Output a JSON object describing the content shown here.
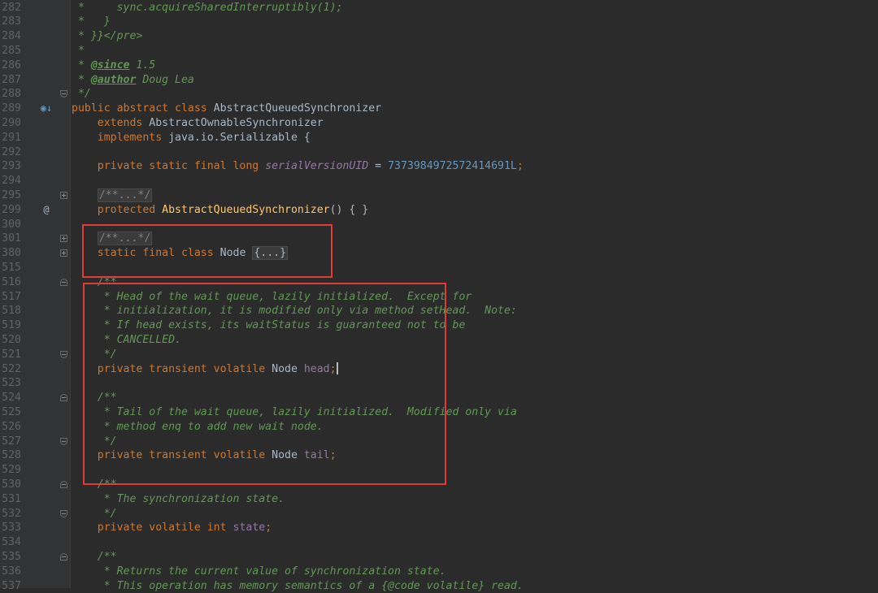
{
  "editor": {
    "lines": [
      {
        "n": "282",
        "fold": "",
        "marker": "",
        "segments": [
          {
            "t": " *     ",
            "c": "doc"
          },
          {
            "t": "sync.acquireSharedInterruptibly(1);",
            "c": "doc"
          }
        ]
      },
      {
        "n": "283",
        "fold": "",
        "marker": "",
        "segments": [
          {
            "t": " *   }",
            "c": "doc"
          }
        ]
      },
      {
        "n": "284",
        "fold": "",
        "marker": "",
        "segments": [
          {
            "t": " * }}</pre>",
            "c": "doc"
          }
        ]
      },
      {
        "n": "285",
        "fold": "",
        "marker": "",
        "segments": [
          {
            "t": " *",
            "c": "doc"
          }
        ]
      },
      {
        "n": "286",
        "fold": "",
        "marker": "",
        "segments": [
          {
            "t": " * ",
            "c": "doc"
          },
          {
            "t": "@since",
            "c": "tag"
          },
          {
            "t": " 1.5",
            "c": "tagv"
          }
        ]
      },
      {
        "n": "287",
        "fold": "",
        "marker": "",
        "segments": [
          {
            "t": " * ",
            "c": "doc"
          },
          {
            "t": "@author",
            "c": "tag"
          },
          {
            "t": " Doug Lea",
            "c": "tagv"
          }
        ]
      },
      {
        "n": "288",
        "fold": "end",
        "marker": "",
        "segments": [
          {
            "t": " */",
            "c": "doc"
          }
        ]
      },
      {
        "n": "289",
        "fold": "",
        "marker": "override",
        "segments": [
          {
            "t": "public abstract class ",
            "c": "kw"
          },
          {
            "t": "AbstractQueuedSynchronizer",
            "c": ""
          }
        ]
      },
      {
        "n": "290",
        "fold": "",
        "marker": "",
        "segments": [
          {
            "t": "    extends ",
            "c": "kw"
          },
          {
            "t": "AbstractOwnableSynchronizer",
            "c": ""
          }
        ]
      },
      {
        "n": "291",
        "fold": "",
        "marker": "",
        "segments": [
          {
            "t": "    implements ",
            "c": "kw"
          },
          {
            "t": "java.io.Serializable {",
            "c": ""
          }
        ]
      },
      {
        "n": "292",
        "fold": "",
        "marker": "",
        "segments": []
      },
      {
        "n": "293",
        "fold": "",
        "marker": "",
        "segments": [
          {
            "t": "    private static final long ",
            "c": "kw"
          },
          {
            "t": "serialVersionUID",
            "c": "ifield"
          },
          {
            "t": " = ",
            "c": ""
          },
          {
            "t": "7373984972572414691L",
            "c": "num"
          },
          {
            "t": ";",
            "c": "kw"
          }
        ]
      },
      {
        "n": "294",
        "fold": "",
        "marker": "",
        "segments": []
      },
      {
        "n": "295",
        "fold": "col",
        "marker": "",
        "segments": [
          {
            "t": "    ",
            "c": ""
          },
          {
            "t": "/**...*/",
            "c": "folded-doc"
          }
        ]
      },
      {
        "n": "299",
        "fold": "",
        "marker": "impl",
        "segments": [
          {
            "t": "    protected ",
            "c": "kw"
          },
          {
            "t": "AbstractQueuedSynchronizer",
            "c": "fn"
          },
          {
            "t": "() { }",
            "c": ""
          }
        ]
      },
      {
        "n": "300",
        "fold": "",
        "marker": "",
        "segments": []
      },
      {
        "n": "301",
        "fold": "col",
        "marker": "",
        "segments": [
          {
            "t": "    ",
            "c": ""
          },
          {
            "t": "/**...*/",
            "c": "folded-doc"
          }
        ]
      },
      {
        "n": "380",
        "fold": "col",
        "marker": "",
        "segments": [
          {
            "t": "    static final class ",
            "c": "kw"
          },
          {
            "t": "Node ",
            "c": ""
          },
          {
            "t": "{...}",
            "c": "folded"
          }
        ]
      },
      {
        "n": "515",
        "fold": "",
        "marker": "",
        "segments": []
      },
      {
        "n": "516",
        "fold": "start",
        "marker": "",
        "segments": [
          {
            "t": "    /**",
            "c": "doc"
          }
        ]
      },
      {
        "n": "517",
        "fold": "",
        "marker": "",
        "segments": [
          {
            "t": "     * Head of the wait queue, lazily initialized.  Except for",
            "c": "doc"
          }
        ]
      },
      {
        "n": "518",
        "fold": "",
        "marker": "",
        "segments": [
          {
            "t": "     * initialization, it is modified only via method setHead.  Note:",
            "c": "doc"
          }
        ]
      },
      {
        "n": "519",
        "fold": "",
        "marker": "",
        "segments": [
          {
            "t": "     * If head exists, its waitStatus is guaranteed not to be",
            "c": "doc"
          }
        ]
      },
      {
        "n": "520",
        "fold": "",
        "marker": "",
        "segments": [
          {
            "t": "     * CANCELLED.",
            "c": "doc"
          }
        ]
      },
      {
        "n": "521",
        "fold": "end",
        "marker": "",
        "segments": [
          {
            "t": "     */",
            "c": "doc"
          }
        ]
      },
      {
        "n": "522",
        "fold": "",
        "marker": "",
        "segments": [
          {
            "t": "    private transient volatile ",
            "c": "kw"
          },
          {
            "t": "Node ",
            "c": ""
          },
          {
            "t": "head",
            "c": "field"
          },
          {
            "t": ";",
            "c": "kw"
          },
          {
            "t": "|",
            "c": "caret"
          }
        ]
      },
      {
        "n": "523",
        "fold": "",
        "marker": "",
        "segments": []
      },
      {
        "n": "524",
        "fold": "start",
        "marker": "",
        "segments": [
          {
            "t": "    /**",
            "c": "doc"
          }
        ]
      },
      {
        "n": "525",
        "fold": "",
        "marker": "",
        "segments": [
          {
            "t": "     * Tail of the wait queue, lazily initialized.  Modified only via",
            "c": "doc"
          }
        ]
      },
      {
        "n": "526",
        "fold": "",
        "marker": "",
        "segments": [
          {
            "t": "     * method enq to add new wait node.",
            "c": "doc"
          }
        ]
      },
      {
        "n": "527",
        "fold": "end",
        "marker": "",
        "segments": [
          {
            "t": "     */",
            "c": "doc"
          }
        ]
      },
      {
        "n": "528",
        "fold": "",
        "marker": "",
        "segments": [
          {
            "t": "    private transient volatile ",
            "c": "kw"
          },
          {
            "t": "Node ",
            "c": ""
          },
          {
            "t": "tail",
            "c": "field"
          },
          {
            "t": ";",
            "c": "kw"
          }
        ]
      },
      {
        "n": "529",
        "fold": "",
        "marker": "",
        "segments": []
      },
      {
        "n": "530",
        "fold": "start",
        "marker": "",
        "segments": [
          {
            "t": "    /**",
            "c": "doc"
          }
        ]
      },
      {
        "n": "531",
        "fold": "",
        "marker": "",
        "segments": [
          {
            "t": "     * The synchronization state.",
            "c": "doc"
          }
        ]
      },
      {
        "n": "532",
        "fold": "end",
        "marker": "",
        "segments": [
          {
            "t": "     */",
            "c": "doc"
          }
        ]
      },
      {
        "n": "533",
        "fold": "",
        "marker": "",
        "segments": [
          {
            "t": "    private volatile int ",
            "c": "kw"
          },
          {
            "t": "state",
            "c": "field"
          },
          {
            "t": ";",
            "c": "kw"
          }
        ]
      },
      {
        "n": "534",
        "fold": "",
        "marker": "",
        "segments": []
      },
      {
        "n": "535",
        "fold": "start",
        "marker": "",
        "segments": [
          {
            "t": "    /**",
            "c": "doc"
          }
        ]
      },
      {
        "n": "536",
        "fold": "",
        "marker": "",
        "segments": [
          {
            "t": "     * Returns the current value of synchronization state.",
            "c": "doc"
          }
        ]
      },
      {
        "n": "537",
        "fold": "",
        "marker": "",
        "segments": [
          {
            "t": "     * This operation has memory semantics of a {@code volatile} read.",
            "c": "doc"
          }
        ]
      }
    ],
    "markers": {
      "override": "◉↓",
      "impl": "@"
    },
    "colors": {
      "background": "#2b2b2b",
      "gutter": "#313335",
      "keyword": "#cc7832",
      "comment": "#629755",
      "field": "#9876aa",
      "number": "#6897bb",
      "highlight_box": "#e03a3a"
    }
  }
}
